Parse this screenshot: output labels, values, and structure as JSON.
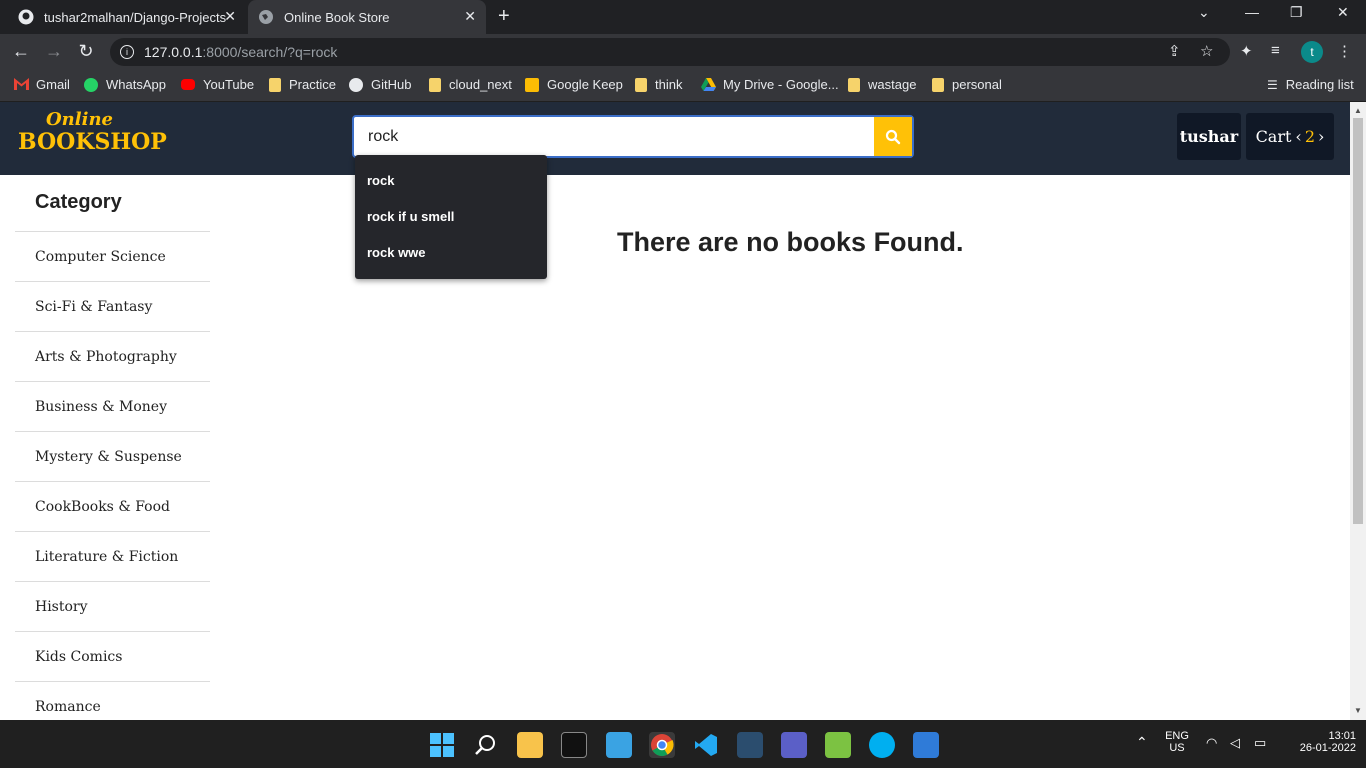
{
  "browser": {
    "tabs": [
      {
        "title": "tushar2malhan/Django-Projects",
        "icon": "github-icon"
      },
      {
        "title": "Online Book Store",
        "icon": "globe-icon"
      }
    ],
    "url_host": "127.0.0.1",
    "url_path": ":8000/search/?q=rock",
    "bookmarks": [
      "Gmail",
      "WhatsApp",
      "YouTube",
      "Practice",
      "GitHub",
      "cloud_next",
      "Google Keep",
      "think",
      "My Drive - Google...",
      "wastage",
      "personal"
    ],
    "reading_list": "Reading list",
    "profile_initial": "t"
  },
  "site": {
    "logo_top": "Online",
    "logo_bottom": "BOOKSHOP",
    "search_value": "rock",
    "user_label": "tushar",
    "cart_label": "Cart",
    "cart_count": "2",
    "suggestions": [
      "rock",
      "rock if u smell",
      "rock wwe"
    ],
    "category_title": "Category",
    "categories": [
      "Computer Science",
      "Sci-Fi & Fantasy",
      "Arts & Photography",
      "Business & Money",
      "Mystery & Suspense",
      "CookBooks & Food",
      "Literature & Fiction",
      "History",
      "Kids Comics",
      "Romance"
    ],
    "message": "There are no books Found."
  },
  "taskbar": {
    "lang1": "ENG",
    "lang2": "US",
    "time": "13:01",
    "date": "26-01-2022"
  },
  "colors": {
    "accent": "#ffc107",
    "header_bg": "#212b3a",
    "focus_border": "#3b6ec8"
  }
}
